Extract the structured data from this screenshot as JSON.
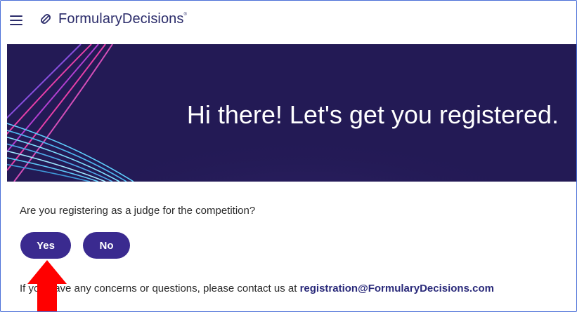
{
  "header": {
    "brand": "FormularyDecisions",
    "brand_mark": "®"
  },
  "hero": {
    "title": "Hi there! Let's get you registered."
  },
  "form": {
    "question": "Are you registering as a judge for the competition?",
    "yes_label": "Yes",
    "no_label": "No"
  },
  "footer": {
    "contact_text": "If you have any concerns or questions, please contact us at ",
    "contact_email": "registration@FormularyDecisions.com"
  },
  "colors": {
    "brand_navy": "#2c2d6b",
    "button_purple": "#3a2a8f",
    "hero_bg": "#231a55",
    "annotation_arrow": "#ff0000"
  },
  "icons": [
    "menu-icon",
    "formulary-logo-icon",
    "red-arrow-annotation"
  ]
}
